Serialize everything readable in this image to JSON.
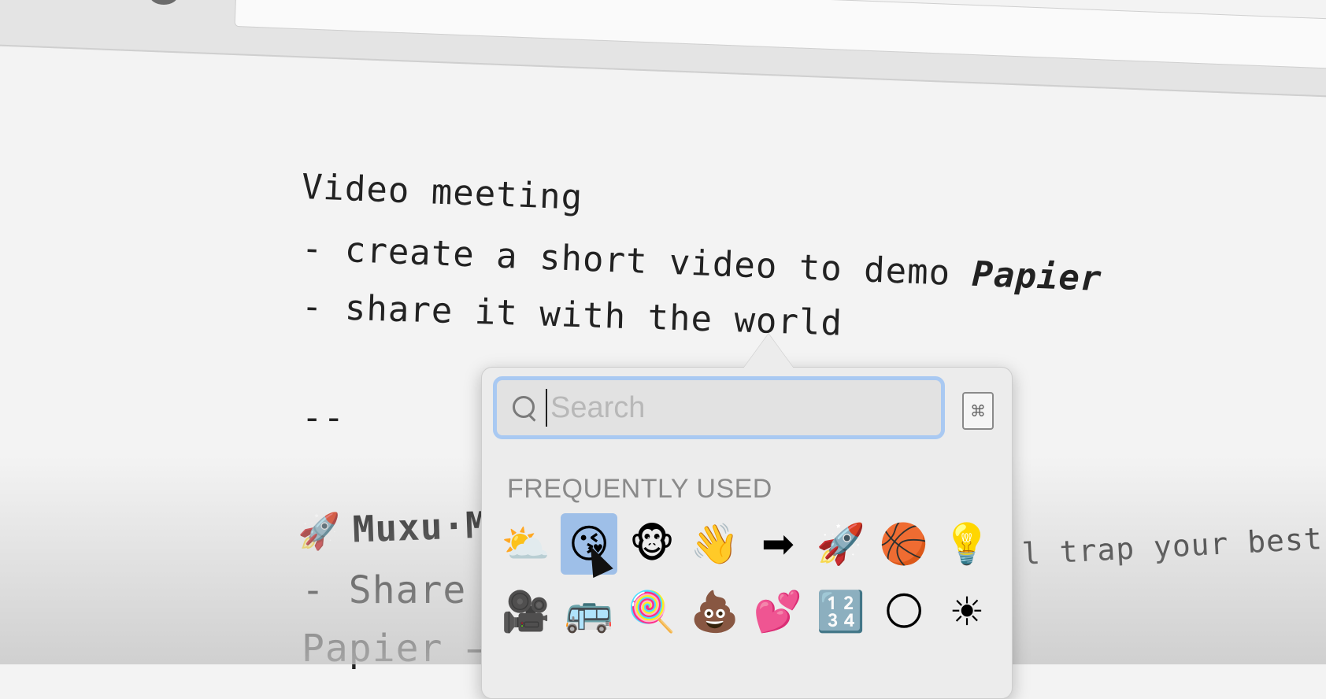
{
  "editor": {
    "line1": "Video meeting",
    "line2_prefix": "- create a short video to demo ",
    "line2_bold": "Papier",
    "line3": "- share it with the world",
    "line4": "--",
    "line5_emoji": "🚀",
    "line5_text": "Muxu·M",
    "line6": "- Share tl",
    "line7": "Papier →",
    "line8": "l trap your best thought"
  },
  "emoji_picker": {
    "search_placeholder": "Search",
    "section_label": "FREQUENTLY USED",
    "selected_index": 1,
    "emojis": [
      "⛅",
      "😘",
      "🐵",
      "👋",
      "➡",
      "🚀",
      "🏀",
      "💡",
      "🎥",
      "🚌",
      "🍭",
      "💩",
      "💕",
      "🔢",
      "🌕",
      "☀"
    ],
    "keyboard_icon": "⌘"
  },
  "colors": {
    "search_focus": "#a9c9f2",
    "selected_cell": "#9ebfe8"
  }
}
